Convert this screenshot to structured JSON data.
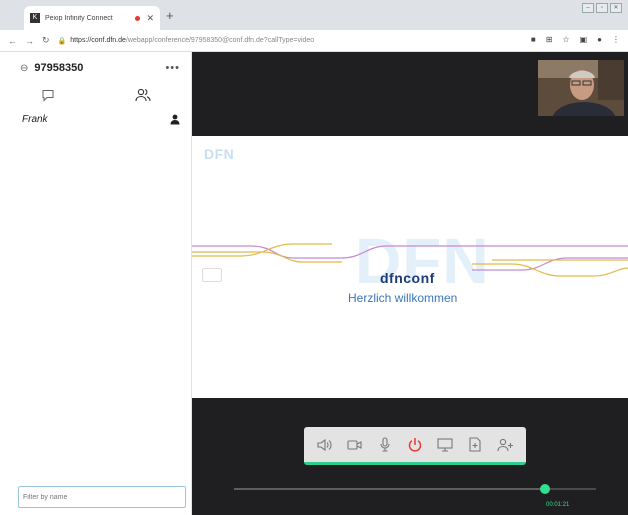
{
  "browser": {
    "tab_title": "Pexip Infinity Connect",
    "tab_favicon": "K",
    "url_host": "https://conf.dfn.de",
    "url_path": "/webapp/conference/97958350@conf.dfn.de?callType=video"
  },
  "sidebar": {
    "conference_id": "97958350",
    "participants": [
      {
        "name": "Frank"
      }
    ],
    "filter_placeholder": "Filter by name"
  },
  "stage": {
    "slide_logo_small": "DFN",
    "slide_logo_big": "DFN",
    "brand": "dfnconf",
    "welcome": "Herzlich willkommen",
    "progress_fraction": 0.86,
    "timer": "00:01:21"
  },
  "colors": {
    "accent": "#2ee08f",
    "hangup": "#e53935"
  },
  "icons": [
    "link-icon",
    "more-icon",
    "chat-icon",
    "participants-icon",
    "user-icon",
    "speaker-icon",
    "camera-icon",
    "microphone-icon",
    "power-icon",
    "screen-share-icon",
    "file-share-icon",
    "add-user-icon"
  ]
}
